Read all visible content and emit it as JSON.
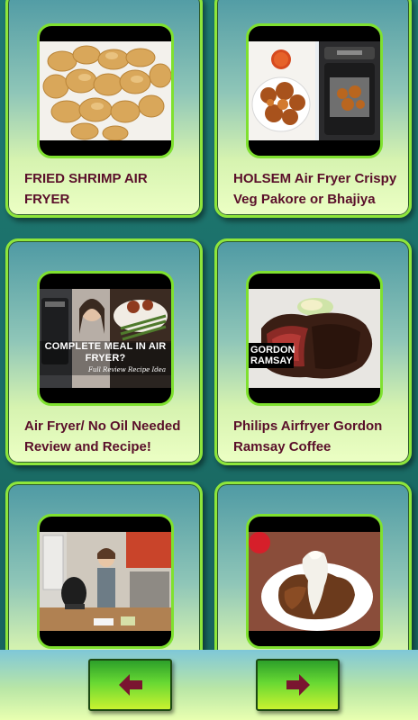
{
  "cards": [
    {
      "title": "FRIED SHRIMP AIR FRYER",
      "thumb": "fried-shrimp-image"
    },
    {
      "title": "HOLSEM Air Fryer Crispy Veg Pakore or Bhajiya",
      "thumb": "pakora-airfryer-image"
    },
    {
      "title": "Air Fryer/ No Oil Needed Review and Recipe!",
      "thumb": "complete-meal-image",
      "overlay": "COMPLETE MEAL IN AIR FRYER?",
      "subtitle": "Full Review Recipe Idea"
    },
    {
      "title": "Philips Airfryer Gordon Ramsay Coffee",
      "thumb": "steak-image",
      "overlay": "GORDON RAMSAY"
    },
    {
      "title": "",
      "thumb": "kitchen-demo-image"
    },
    {
      "title": "",
      "thumb": "crusted-steak-image"
    }
  ],
  "nav": {
    "prev_icon": "arrow-left-icon",
    "next_icon": "arrow-right-icon",
    "accent": "#7fe12f",
    "arrow_color": "#7a1530"
  }
}
